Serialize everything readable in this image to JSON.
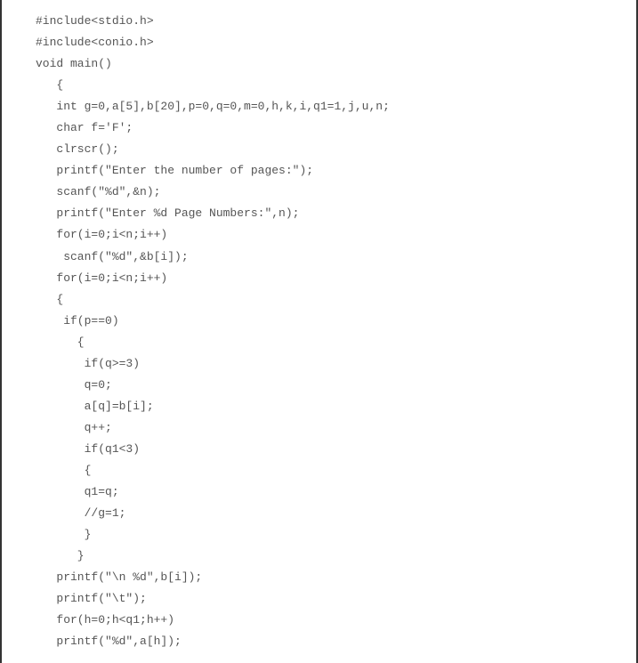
{
  "code_lines": [
    "#include<stdio.h>",
    "#include<conio.h>",
    "void main()",
    "   {",
    "   int g=0,a[5],b[20],p=0,q=0,m=0,h,k,i,q1=1,j,u,n;",
    "   char f='F';",
    "   clrscr();",
    "   printf(\"Enter the number of pages:\");",
    "   scanf(\"%d\",&n);",
    "   printf(\"Enter %d Page Numbers:\",n);",
    "   for(i=0;i<n;i++)",
    "    scanf(\"%d\",&b[i]);",
    "   for(i=0;i<n;i++)",
    "   {",
    "    if(p==0)",
    "      {",
    "       if(q>=3)",
    "       q=0;",
    "       a[q]=b[i];",
    "       q++;",
    "       if(q1<3)",
    "       {",
    "       q1=q;",
    "       //g=1;",
    "       }",
    "      }",
    "   printf(\"\\n %d\",b[i]);",
    "   printf(\"\\t\");",
    "   for(h=0;h<q1;h++)",
    "   printf(\"%d\",a[h]);"
  ]
}
